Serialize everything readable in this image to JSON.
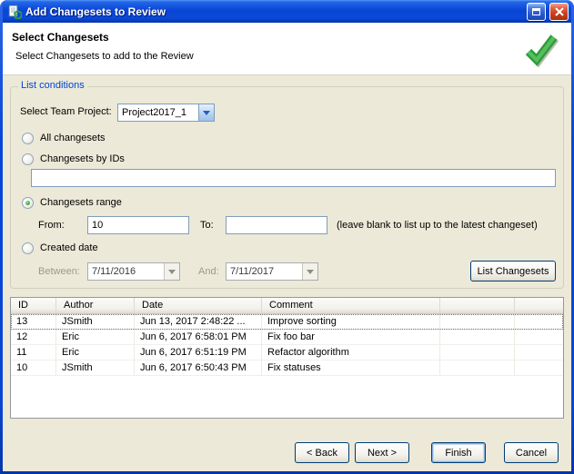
{
  "window": {
    "title": "Add Changesets to Review"
  },
  "header": {
    "title": "Select Changesets",
    "subtitle": "Select Changesets to add to the Review"
  },
  "conditions": {
    "legend": "List conditions",
    "team_project_label": "Select Team Project:",
    "team_project_value": "Project2017_1",
    "all_label": "All changesets",
    "all_checked": false,
    "ids_label": "Changesets by IDs",
    "ids_checked": false,
    "ids_value": "",
    "range_label": "Changesets range",
    "range_checked": true,
    "from_label": "From:",
    "from_value": "10",
    "to_label": "To:",
    "to_value": "",
    "range_hint": "(leave blank to list up to the latest changeset)",
    "created_label": "Created date",
    "created_checked": false,
    "between_label": "Between:",
    "between_value": "7/11/2016",
    "and_label": "And:",
    "and_value": "7/11/2017",
    "list_button": "List Changesets"
  },
  "table": {
    "columns": [
      "ID",
      "Author",
      "Date",
      "Comment",
      ""
    ],
    "rows": [
      {
        "id": "13",
        "author": "JSmith",
        "date": "Jun 13, 2017 2:48:22 ...",
        "comment": "Improve sorting",
        "selected": true
      },
      {
        "id": "12",
        "author": "Eric",
        "date": "Jun 6, 2017 6:58:01 PM",
        "comment": "Fix foo bar",
        "selected": false
      },
      {
        "id": "11",
        "author": "Eric",
        "date": "Jun 6, 2017 6:51:19 PM",
        "comment": "Refactor algorithm",
        "selected": false
      },
      {
        "id": "10",
        "author": "JSmith",
        "date": "Jun 6, 2017 6:50:43 PM",
        "comment": "Fix statuses",
        "selected": false
      }
    ]
  },
  "footer": {
    "back": "< Back",
    "next": "Next >",
    "finish": "Finish",
    "cancel": "Cancel"
  }
}
